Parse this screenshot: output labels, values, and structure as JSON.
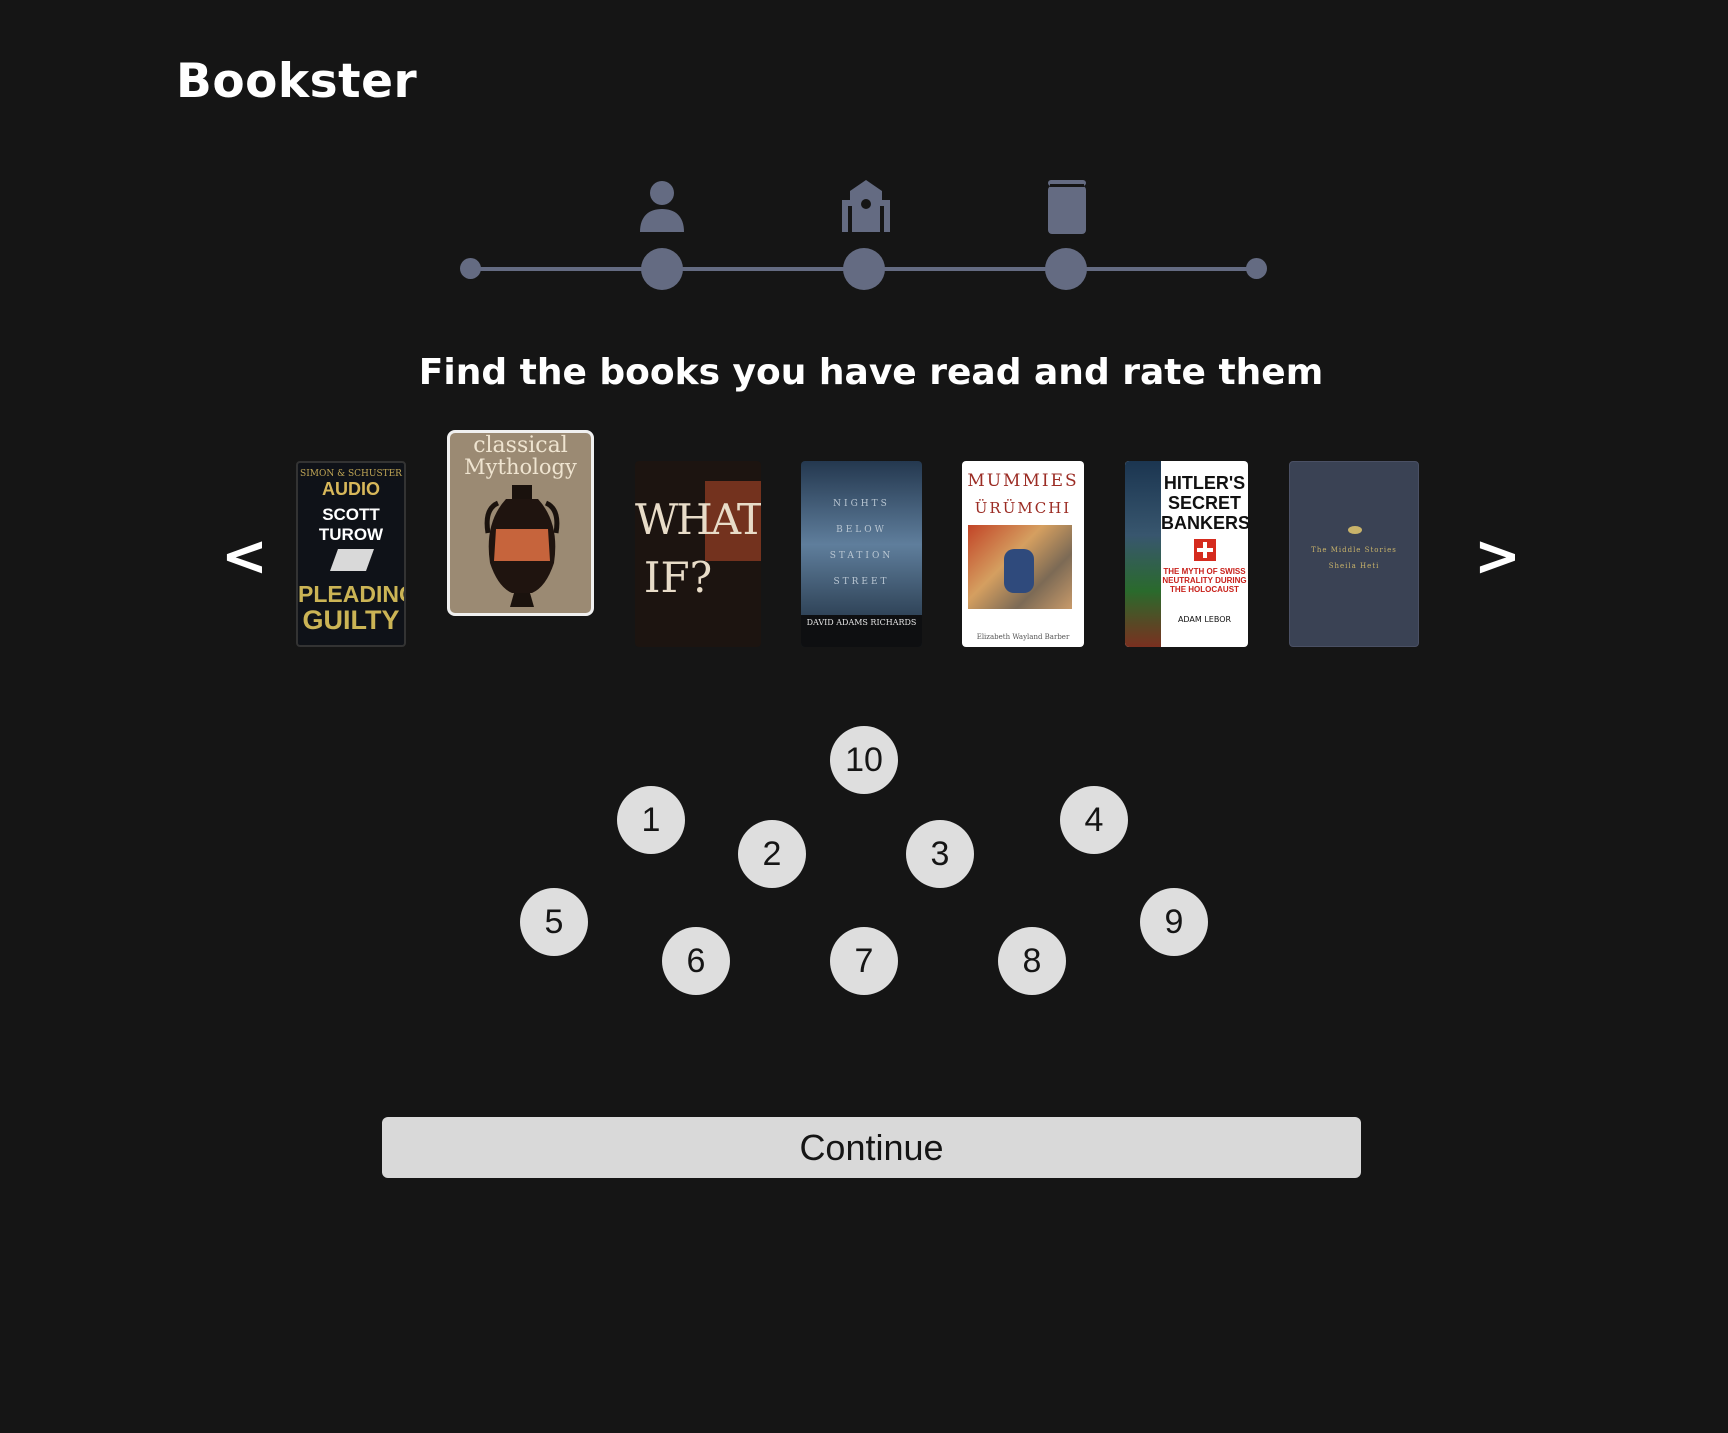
{
  "brand": {
    "name": "Bookster"
  },
  "stepper": {
    "steps": [
      {
        "icon": "user-icon"
      },
      {
        "icon": "school-icon"
      },
      {
        "icon": "book-icon"
      }
    ],
    "color": "#646b82"
  },
  "heading": "Find the books you have read and rate them",
  "carousel": {
    "prev_label": "<",
    "next_label": ">",
    "books": [
      {
        "icon": "book-cover-pleading-guilty",
        "top": "AUDIO",
        "author": "SCOTT TUROW",
        "title_a": "PLEADING",
        "title_b": "GUILTY",
        "selected": false
      },
      {
        "icon": "book-cover-classical-mythology",
        "title_a": "classical",
        "title_b": "Mythology",
        "selected": true
      },
      {
        "icon": "book-cover-what-if",
        "title_a": "WHAT",
        "title_b": "IF?",
        "selected": false
      },
      {
        "icon": "book-cover-nights-below-station-street",
        "title_a": "NIGHTS BELOW STATION STREET",
        "author": "DAVID ADAMS RICHARDS",
        "selected": false
      },
      {
        "icon": "book-cover-mummies-of-urumchi",
        "title_a": "MUMMIES",
        "title_b": "ÜRÜMCHI",
        "author": "Elizabeth Wayland Barber",
        "selected": false
      },
      {
        "icon": "book-cover-hitlers-secret-bankers",
        "title_a": "HITLER'S SECRET BANKERS",
        "subtitle": "THE MYTH OF SWISS NEUTRALITY DURING THE HOLOCAUST",
        "author": "ADAM LEBOR",
        "selected": false
      },
      {
        "icon": "book-cover-the-middle-stories",
        "title_a": "The Middle Stories",
        "author": "Sheila Heti",
        "selected": false
      }
    ]
  },
  "ratings": [
    "10",
    "1",
    "2",
    "3",
    "4",
    "5",
    "6",
    "7",
    "8",
    "9"
  ],
  "continue_label": "Continue",
  "colors": {
    "background": "#151515",
    "accent": "#646b82",
    "bubble": "#dedede",
    "button": "#d9d9d9"
  }
}
